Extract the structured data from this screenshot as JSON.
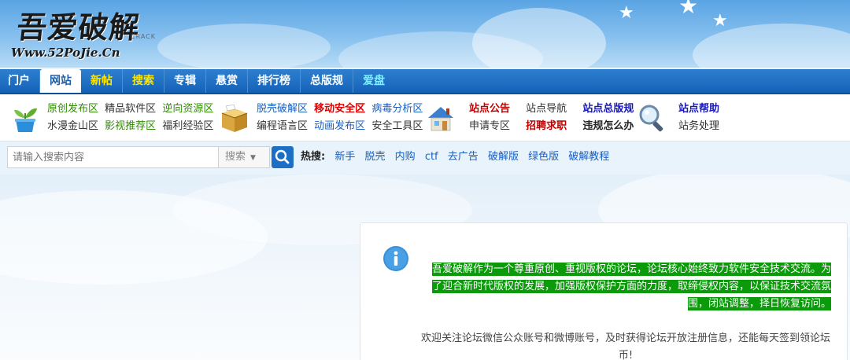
{
  "logo": {
    "name": "吾爱破解",
    "tag": "CRACK",
    "url": "Www.52PoJie.Cn"
  },
  "nav": {
    "items": [
      {
        "label": "门户"
      },
      {
        "label": "网站"
      },
      {
        "label": "新帖"
      },
      {
        "label": "搜索"
      },
      {
        "label": "专辑"
      },
      {
        "label": "悬赏"
      },
      {
        "label": "排行榜"
      },
      {
        "label": "总版规"
      },
      {
        "label": "爱盘"
      }
    ]
  },
  "links": {
    "g1": {
      "icon": "plant-pot-icon",
      "row1": [
        "原创发布区",
        "精品软件区",
        "逆向资源区"
      ],
      "row2": [
        "水漫金山区",
        "影视推荐区",
        "福利经验区"
      ]
    },
    "g2": {
      "icon": "box-icon",
      "row1": [
        "脱壳破解区",
        "移动安全区",
        "病毒分析区"
      ],
      "row2": [
        "编程语言区",
        "动画发布区",
        "安全工具区"
      ]
    },
    "g3": {
      "icon": "house-icon",
      "row1": [
        "站点公告",
        "站点导航",
        "站点总版规"
      ],
      "row2": [
        "申请专区",
        "招聘求职",
        "违规怎么办"
      ]
    },
    "g4": {
      "icon": "magnifier-icon",
      "row1": [
        "站点帮助"
      ],
      "row2": [
        "站务处理"
      ]
    }
  },
  "search": {
    "placeholder": "请输入搜索内容",
    "select_label": "搜索",
    "button_icon": "search-icon"
  },
  "hot": {
    "label": "热搜:",
    "items": [
      "新手",
      "脱壳",
      "内购",
      "ctf",
      "去广告",
      "破解版",
      "绿色版",
      "破解教程"
    ]
  },
  "notice": {
    "icon": "info-icon",
    "line1": "吾爱破解作为一个尊重原创、重视版权的论坛，论坛核心始终致力软件安全技术交流。为",
    "line2": "了迎合新时代版权的发展，加强版权保护方面的力度，取缔侵权内容，以保证技术交流氛",
    "line3": "围，闭站调整，择日恢复访问。",
    "sub1": "欢迎关注论坛微信公众账号和微博账号，及时获得论坛开放注册信息，还能每天签到领论坛",
    "sub2": "币!"
  },
  "colors": {
    "nav_blue": "#1462b8",
    "highlight_green": "#0a9a0a",
    "link_blue": "#1a5fc0",
    "link_green": "#2e8b00",
    "alert_red": "#e00000"
  }
}
